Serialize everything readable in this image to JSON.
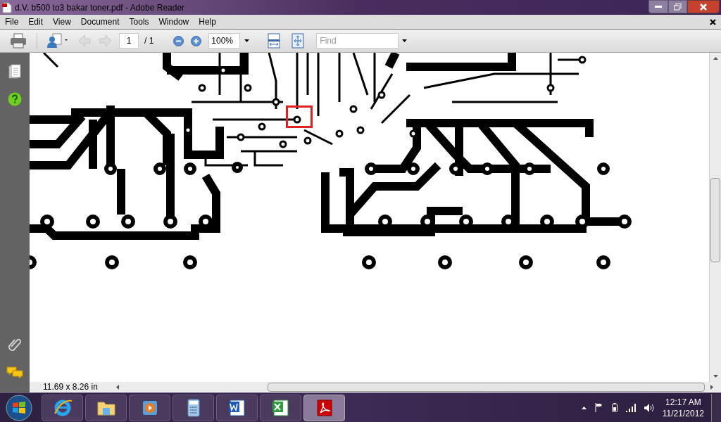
{
  "window": {
    "title": "d.V. b500 to3 bakar toner.pdf - Adobe Reader"
  },
  "menu_bar": [
    "File",
    "Edit",
    "View",
    "Document",
    "Tools",
    "Window",
    "Help"
  ],
  "toolbar": {
    "page_number": "1",
    "page_total": "/ 1",
    "zoom": "100%",
    "find": {
      "placeholder": "Find"
    }
  },
  "status_bar": {
    "page_size": "11.69 x 8.26 in"
  },
  "taskbar": {
    "apps": [
      {
        "kind": "ie",
        "selected": false
      },
      {
        "kind": "explorer",
        "selected": false
      },
      {
        "kind": "media",
        "selected": false
      },
      {
        "kind": "calculator",
        "selected": false
      },
      {
        "kind": "word",
        "selected": false
      },
      {
        "kind": "excel",
        "selected": false
      },
      {
        "kind": "reader",
        "selected": true
      }
    ],
    "clock": {
      "time": "12:17 AM",
      "date": "11/21/2012"
    }
  }
}
